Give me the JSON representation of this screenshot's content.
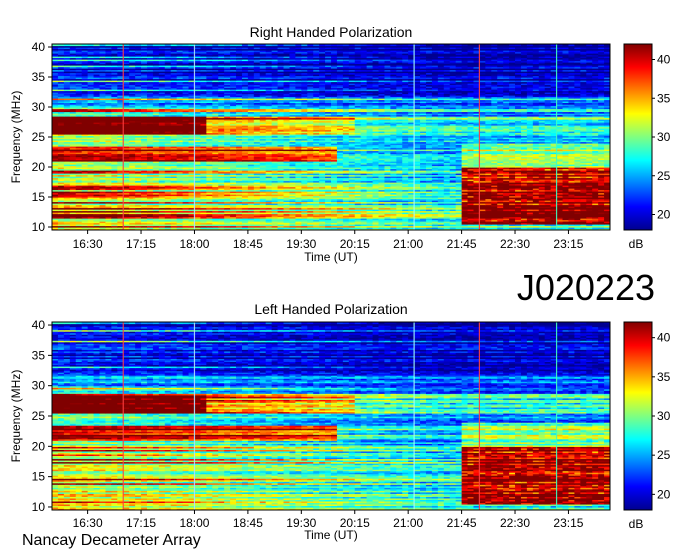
{
  "observation_id": "J020223",
  "observatory": "Nancay Decameter Array",
  "colorbar": {
    "unit": "dB",
    "ticks": [
      "20",
      "25",
      "30",
      "35",
      "40"
    ],
    "range_db": [
      18,
      42
    ],
    "colormap": [
      "#00008f",
      "#0000ff",
      "#0080ff",
      "#00ffff",
      "#80ff80",
      "#ffff00",
      "#ff8000",
      "#ff0000",
      "#800000"
    ]
  },
  "chart_data": [
    {
      "type": "heatmap",
      "title": "Right Handed Polarization",
      "xlabel": "Time (UT)",
      "ylabel": "Frequency (MHz)",
      "xlim": [
        "16:00",
        "23:50"
      ],
      "ylim": [
        9.5,
        40.5
      ],
      "x_tick_labels": [
        "16:30",
        "17:15",
        "18:00",
        "18:45",
        "19:30",
        "20:15",
        "21:00",
        "21:45",
        "22:30",
        "23:15"
      ],
      "y_tick_labels": [
        "10",
        "15",
        "20",
        "25",
        "30",
        "35",
        "40"
      ],
      "z_unit": "dB",
      "zlim": [
        18,
        42
      ],
      "features": {
        "strong_band_mhz": [
          25.5,
          28.5
        ],
        "strong_band_until": "18:10",
        "intense_region_start": "21:45",
        "intense_region_freq_mhz": [
          10.5,
          20
        ],
        "vertical_markers": [
          "17:00",
          "18:00",
          "21:05",
          "22:00",
          "23:05"
        ]
      }
    },
    {
      "type": "heatmap",
      "title": "Left Handed Polarization",
      "xlabel": "Time (UT)",
      "ylabel": "Frequency (MHz)",
      "xlim": [
        "16:00",
        "23:50"
      ],
      "ylim": [
        9.5,
        40.5
      ],
      "x_tick_labels": [
        "16:30",
        "17:15",
        "18:00",
        "18:45",
        "19:30",
        "20:15",
        "21:00",
        "21:45",
        "22:30",
        "23:15"
      ],
      "y_tick_labels": [
        "10",
        "15",
        "20",
        "25",
        "30",
        "35",
        "40"
      ],
      "z_unit": "dB",
      "zlim": [
        18,
        42
      ],
      "features": {
        "strong_band_mhz": [
          25.5,
          28.5
        ],
        "strong_band_until": "18:10",
        "intense_region_start": "21:45",
        "intense_region_freq_mhz": [
          10.5,
          20
        ],
        "vertical_markers": [
          "17:00",
          "18:00",
          "21:05",
          "22:00",
          "23:05"
        ]
      }
    }
  ]
}
